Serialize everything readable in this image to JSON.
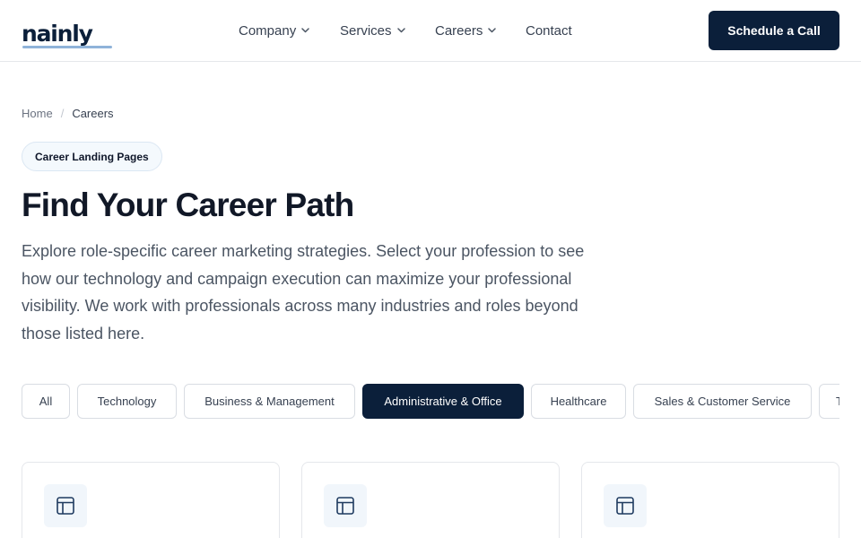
{
  "header": {
    "logo_text": "nainly",
    "nav": [
      {
        "label": "Company",
        "has_dropdown": true
      },
      {
        "label": "Services",
        "has_dropdown": true
      },
      {
        "label": "Careers",
        "has_dropdown": true
      },
      {
        "label": "Contact",
        "has_dropdown": false
      }
    ],
    "cta_label": "Schedule a Call"
  },
  "breadcrumb": {
    "home": "Home",
    "separator": "/",
    "current": "Careers"
  },
  "hero": {
    "badge": "Career Landing Pages",
    "title": "Find Your Career Path",
    "description": "Explore role-specific career marketing strategies. Select your profession to see how our technology and campaign execution can maximize your professional visibility. We work with professionals across many industries and roles beyond those listed here."
  },
  "filters": {
    "items": [
      "All",
      "Technology",
      "Business & Management",
      "Administrative & Office",
      "Healthcare",
      "Sales & Customer Service",
      "T"
    ],
    "active": "Administrative & Office"
  },
  "cards": [
    {
      "icon": "layout-icon"
    },
    {
      "icon": "layout-icon"
    },
    {
      "icon": "layout-icon"
    }
  ],
  "colors": {
    "brand_navy": "#0b1f3a",
    "logo_underline": "#8fb3d9",
    "body_text": "#4b5563",
    "border": "#e5e7eb"
  }
}
